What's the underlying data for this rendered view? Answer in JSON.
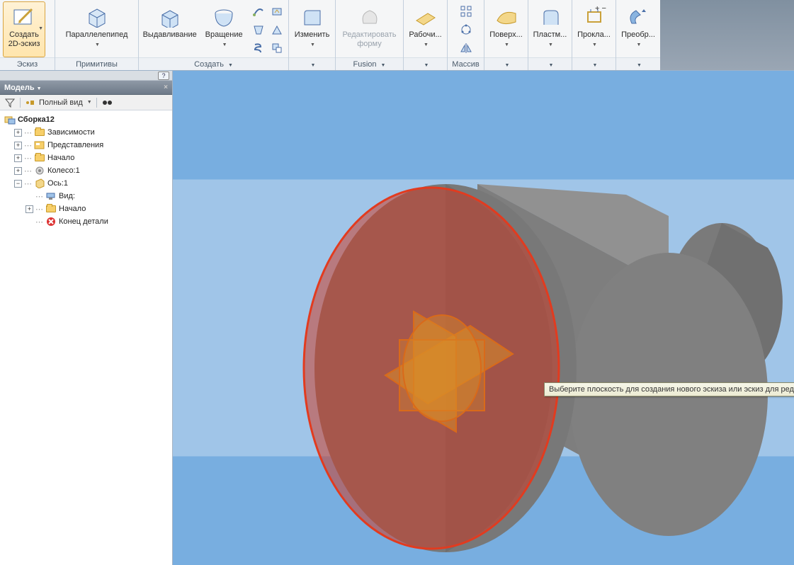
{
  "ribbon": {
    "panels": {
      "sketch": {
        "caption": "Эскиз",
        "create2d": "Создать\n2D-эскиз"
      },
      "primitive": {
        "caption": "Примитивы",
        "box": "Параллелепипед"
      },
      "create": {
        "caption": "Создать",
        "extrude": "Выдавливание",
        "revolve": "Вращение"
      },
      "modify": {
        "caption": "",
        "modify": "Изменить"
      },
      "fusion": {
        "caption": "Fusion",
        "editform": "Редактировать\nформу"
      },
      "work": {
        "caption": "",
        "workfeat": "Рабочи..."
      },
      "array": {
        "caption": "Массив"
      },
      "surface": {
        "caption": "",
        "surface": "Поверх..."
      },
      "plastic": {
        "caption": "",
        "plastic": "Пластм..."
      },
      "gasket": {
        "caption": "",
        "gasket": "Прокла..."
      },
      "transform": {
        "caption": "",
        "transform": "Преобр..."
      }
    }
  },
  "browser": {
    "title": "Модель",
    "view_label": "Полный вид",
    "root": "Сборка12",
    "nodes": {
      "deps": "Зависимости",
      "repr": "Представления",
      "origin": "Начало",
      "wheel": "Колесо:1",
      "axis": "Ось:1",
      "view": "Вид:",
      "origin2": "Начало",
      "endpart": "Конец детали"
    }
  },
  "tooltip": "Выберите плоскость для создания нового эскиза или эскиз для редактирования"
}
